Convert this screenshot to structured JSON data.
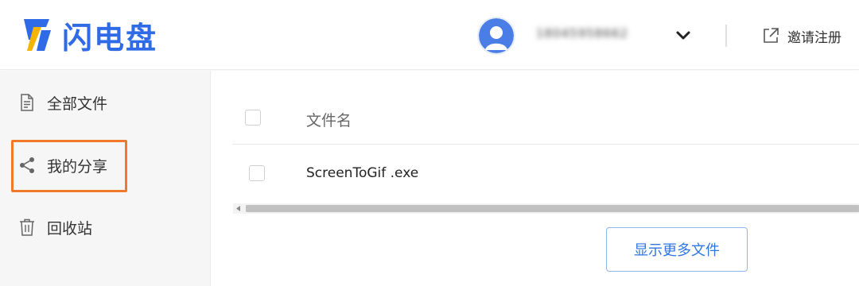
{
  "header": {
    "logo_text": "闪电盘",
    "username": "18045958662",
    "invite_label": "邀请注册",
    "brand_color": "#2f6be6",
    "logo_accent": "#f5b400"
  },
  "sidebar": {
    "items": [
      {
        "label": "全部文件",
        "icon": "document-icon"
      },
      {
        "label": "我的分享",
        "icon": "share-icon",
        "highlighted": true
      },
      {
        "label": "回收站",
        "icon": "trash-icon"
      }
    ],
    "highlight_color": "#f07a2a"
  },
  "file_table": {
    "column_name": "文件名",
    "rows": [
      {
        "name": "ScreenToGif .exe"
      }
    ]
  },
  "show_more_label": "显示更多文件"
}
